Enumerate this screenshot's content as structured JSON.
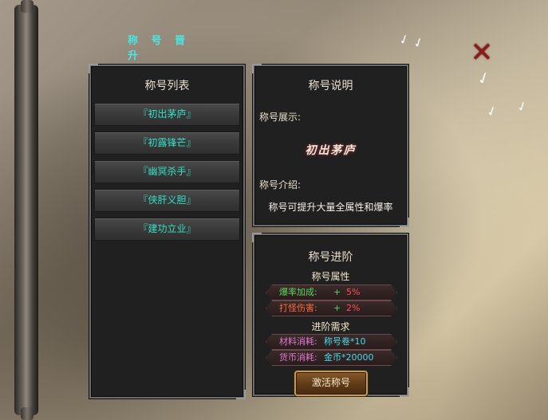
{
  "window": {
    "title": "称 号 晋 升",
    "close_icon": "close-x-icon"
  },
  "colors": {
    "title_cyan": "#49e6e2",
    "list_item_text": "#34e0c4",
    "drop_rate": "#5cd65c",
    "red_value": "#ff5050",
    "material_label": "#e07ad0",
    "material_value": "#4ad8e8"
  },
  "list_panel": {
    "title": "称号列表",
    "items": [
      "『初出茅庐』",
      "『初露锋芒』",
      "『幽冥杀手』",
      "『侠肝义胆』",
      "『建功立业』"
    ]
  },
  "desc_panel": {
    "title": "称号说明",
    "showcase_label": "称号展示:",
    "showcase_name": "初出茅庐",
    "intro_label": "称号介绍:",
    "intro_text": "称号可提升大量全属性和爆率"
  },
  "advance_panel": {
    "title": "称号进阶",
    "attributes_title": "称号属性",
    "attributes": [
      {
        "label": "爆率加成:",
        "plus": "+",
        "value": "5%"
      },
      {
        "label": "打怪伤害:",
        "plus": "+",
        "value": "2%"
      }
    ],
    "requirements_title": "进阶需求",
    "requirements": [
      {
        "label": "材料消耗:",
        "value": "称号卷*10"
      },
      {
        "label": "货币消耗:",
        "value": "金币*20000"
      }
    ],
    "activate_button": "激活称号"
  }
}
